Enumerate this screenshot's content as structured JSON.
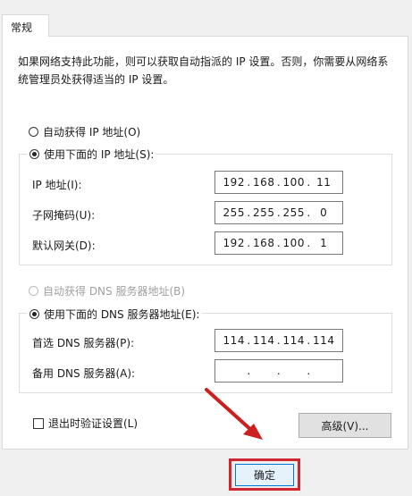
{
  "tab_label": "常规",
  "description": "如果网络支持此功能，则可以获取自动指派的 IP 设置。否则，你需要从网络系统管理员处获得适当的 IP 设置。",
  "ip_section": {
    "auto_option": "自动获得 IP 地址(O)",
    "manual_option": "使用下面的 IP 地址(S):",
    "fields": [
      {
        "label": "IP 地址(I):",
        "octets": [
          "192",
          "168",
          "100",
          "11"
        ]
      },
      {
        "label": "子网掩码(U):",
        "octets": [
          "255",
          "255",
          "255",
          "0"
        ]
      },
      {
        "label": "默认网关(D):",
        "octets": [
          "192",
          "168",
          "100",
          "1"
        ]
      }
    ]
  },
  "dns_section": {
    "auto_option": "自动获得 DNS 服务器地址(B)",
    "manual_option": "使用下面的 DNS 服务器地址(E):",
    "fields": [
      {
        "label": "首选 DNS 服务器(P):",
        "octets": [
          "114",
          "114",
          "114",
          "114"
        ]
      },
      {
        "label": "备用 DNS 服务器(A):",
        "octets": [
          "",
          "",
          "",
          ""
        ]
      }
    ]
  },
  "validate_checkbox": "退出时验证设置(L)",
  "advanced_button": "高级(V)...",
  "ok_button": "确定",
  "colors": {
    "highlight": "#d0262f",
    "arrow": "#cc1f1f",
    "ok_border": "#0078d7"
  }
}
